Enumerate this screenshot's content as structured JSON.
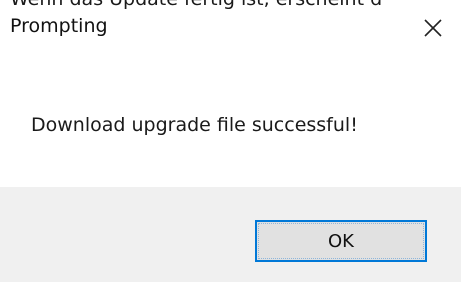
{
  "context_text": "Wenn das Update fertig ist, erscheint d",
  "dialog": {
    "title": "Prompting",
    "close_icon": "close-icon",
    "message": "Download upgrade file successful!",
    "ok_label": "OK"
  },
  "colors": {
    "footer_bg": "#f0f0f0",
    "button_bg": "#e1e1e1",
    "button_focus_border": "#0078d7"
  }
}
